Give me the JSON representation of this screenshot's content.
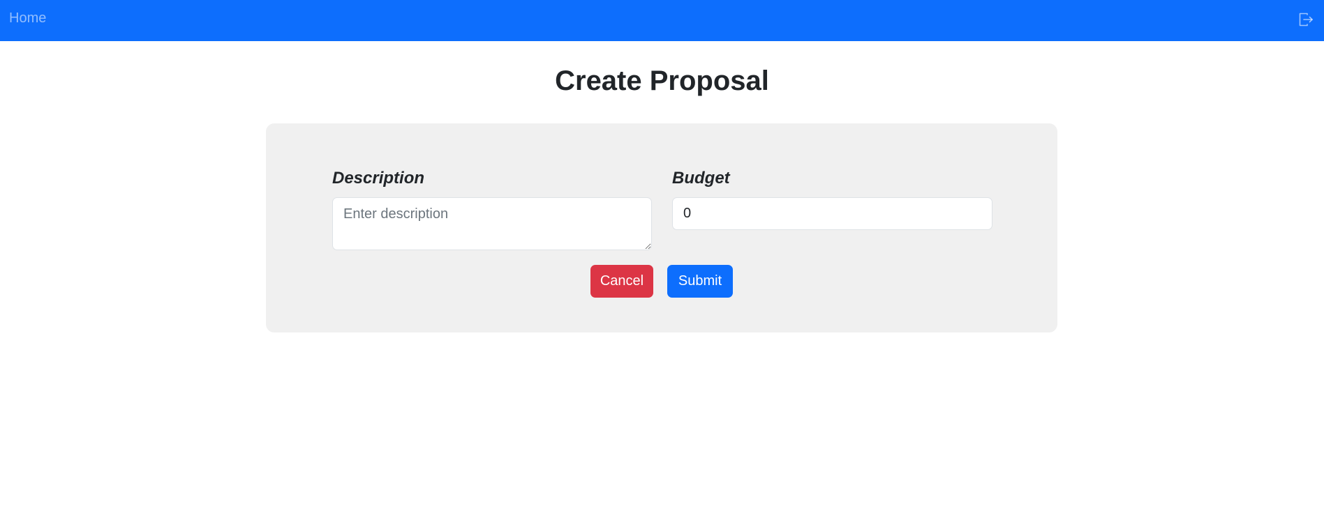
{
  "navbar": {
    "home_label": "Home",
    "logout_icon": "logout-icon",
    "color": "#0d6efd"
  },
  "page": {
    "title": "Create Proposal"
  },
  "form": {
    "description": {
      "label": "Description",
      "placeholder": "Enter description",
      "value": ""
    },
    "budget": {
      "label": "Budget",
      "value": "0"
    },
    "cancel_label": "Cancel",
    "submit_label": "Submit",
    "cancel_color": "#dc3545",
    "submit_color": "#0d6efd"
  }
}
